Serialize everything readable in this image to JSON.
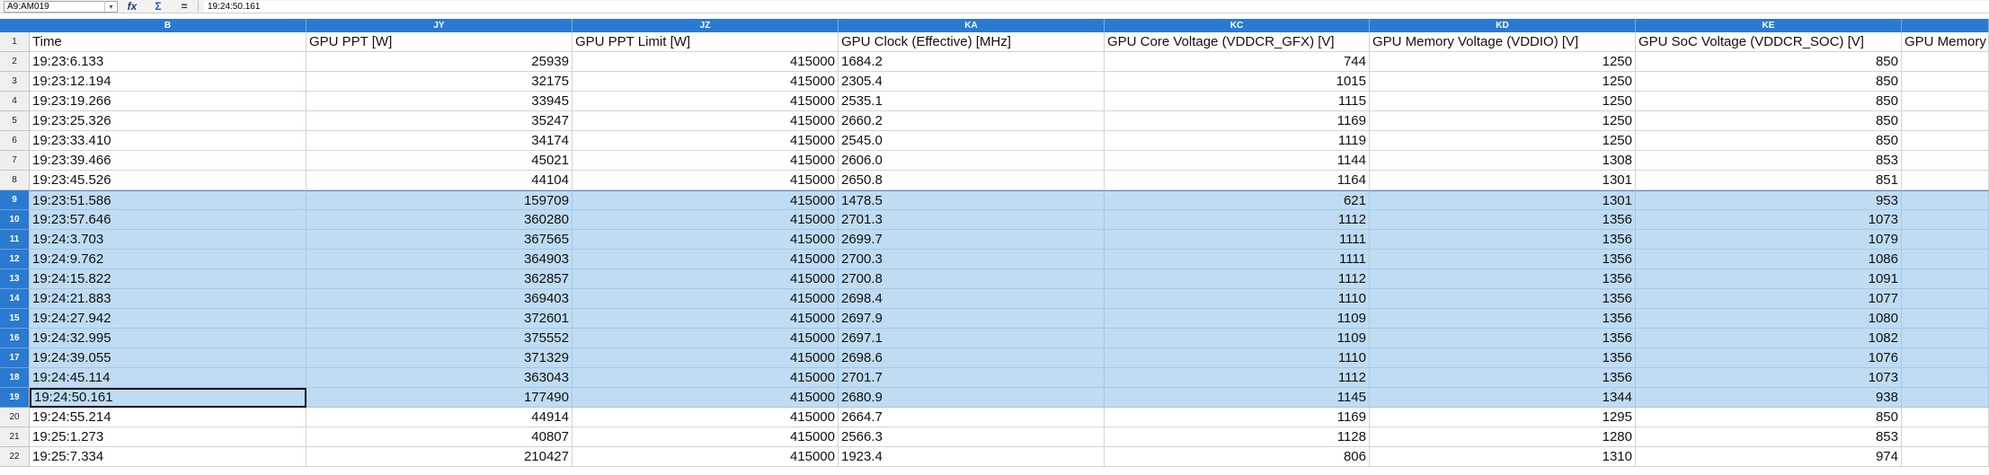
{
  "formula_bar": {
    "name_box": "A9:AM019",
    "function_wizard_icon": "function-wizard-icon",
    "sum_icon": "sum-icon",
    "equals_icon": "equals-icon",
    "content": "19:24:50.161",
    "fx_label": "fx",
    "sum_label": "Σ",
    "eq_label": "="
  },
  "columns": [
    {
      "letter": "B"
    },
    {
      "letter": "JY"
    },
    {
      "letter": "JZ"
    },
    {
      "letter": "KA"
    },
    {
      "letter": "KC"
    },
    {
      "letter": "KD"
    },
    {
      "letter": "KE"
    },
    {
      "letter": ""
    }
  ],
  "header_row": {
    "number": "1",
    "cells": [
      "Time",
      "GPU PPT [W]",
      "GPU PPT Limit [W]",
      "GPU Clock (Effective) [MHz]",
      "GPU Core Voltage (VDDCR_GFX) [V]",
      "GPU Memory Voltage (VDDIO) [V]",
      "GPU SoC Voltage (VDDCR_SOC) [V]",
      "GPU Memory"
    ]
  },
  "rows": [
    {
      "number": "2",
      "selected": false,
      "cells": [
        "19:23:6.133",
        "25939",
        "415000",
        "1684.2",
        "744",
        "1250",
        "850",
        ""
      ]
    },
    {
      "number": "3",
      "selected": false,
      "cells": [
        "19:23:12.194",
        "32175",
        "415000",
        "2305.4",
        "1015",
        "1250",
        "850",
        ""
      ]
    },
    {
      "number": "4",
      "selected": false,
      "cells": [
        "19:23:19.266",
        "33945",
        "415000",
        "2535.1",
        "1115",
        "1250",
        "850",
        ""
      ]
    },
    {
      "number": "5",
      "selected": false,
      "cells": [
        "19:23:25.326",
        "35247",
        "415000",
        "2660.2",
        "1169",
        "1250",
        "850",
        ""
      ]
    },
    {
      "number": "6",
      "selected": false,
      "cells": [
        "19:23:33.410",
        "34174",
        "415000",
        "2545.0",
        "1119",
        "1250",
        "850",
        ""
      ]
    },
    {
      "number": "7",
      "selected": false,
      "cells": [
        "19:23:39.466",
        "45021",
        "415000",
        "2606.0",
        "1144",
        "1308",
        "853",
        ""
      ]
    },
    {
      "number": "8",
      "selected": false,
      "cells": [
        "19:23:45.526",
        "44104",
        "415000",
        "2650.8",
        "1164",
        "1301",
        "851",
        ""
      ]
    },
    {
      "number": "9",
      "selected": true,
      "cells": [
        "19:23:51.586",
        "159709",
        "415000",
        "1478.5",
        "621",
        "1301",
        "953",
        ""
      ]
    },
    {
      "number": "10",
      "selected": true,
      "cells": [
        "19:23:57.646",
        "360280",
        "415000",
        "2701.3",
        "1112",
        "1356",
        "1073",
        ""
      ]
    },
    {
      "number": "11",
      "selected": true,
      "cells": [
        "19:24:3.703",
        "367565",
        "415000",
        "2699.7",
        "1111",
        "1356",
        "1079",
        ""
      ]
    },
    {
      "number": "12",
      "selected": true,
      "cells": [
        "19:24:9.762",
        "364903",
        "415000",
        "2700.3",
        "1111",
        "1356",
        "1086",
        ""
      ]
    },
    {
      "number": "13",
      "selected": true,
      "cells": [
        "19:24:15.822",
        "362857",
        "415000",
        "2700.8",
        "1112",
        "1356",
        "1091",
        ""
      ]
    },
    {
      "number": "14",
      "selected": true,
      "cells": [
        "19:24:21.883",
        "369403",
        "415000",
        "2698.4",
        "1110",
        "1356",
        "1077",
        ""
      ]
    },
    {
      "number": "15",
      "selected": true,
      "cells": [
        "19:24:27.942",
        "372601",
        "415000",
        "2697.9",
        "1109",
        "1356",
        "1080",
        ""
      ]
    },
    {
      "number": "16",
      "selected": true,
      "cells": [
        "19:24:32.995",
        "375552",
        "415000",
        "2697.1",
        "1109",
        "1356",
        "1082",
        ""
      ]
    },
    {
      "number": "17",
      "selected": true,
      "cells": [
        "19:24:39.055",
        "371329",
        "415000",
        "2698.6",
        "1110",
        "1356",
        "1076",
        ""
      ]
    },
    {
      "number": "18",
      "selected": true,
      "cells": [
        "19:24:45.114",
        "363043",
        "415000",
        "2701.7",
        "1112",
        "1356",
        "1073",
        ""
      ]
    },
    {
      "number": "19",
      "selected": true,
      "cursor": true,
      "cells": [
        "19:24:50.161",
        "177490",
        "415000",
        "2680.9",
        "1145",
        "1344",
        "938",
        ""
      ]
    },
    {
      "number": "20",
      "selected": false,
      "cells": [
        "19:24:55.214",
        "44914",
        "415000",
        "2664.7",
        "1169",
        "1295",
        "850",
        ""
      ]
    },
    {
      "number": "21",
      "selected": false,
      "cells": [
        "19:25:1.273",
        "40807",
        "415000",
        "2566.3",
        "1128",
        "1280",
        "853",
        ""
      ]
    },
    {
      "number": "22",
      "selected": false,
      "cells": [
        "19:25:7.334",
        "210427",
        "415000",
        "1923.4",
        "806",
        "1310",
        "974",
        ""
      ]
    }
  ],
  "colors": {
    "header_blue": "#2a7ad2",
    "selection_fill": "#bfdcf2"
  }
}
